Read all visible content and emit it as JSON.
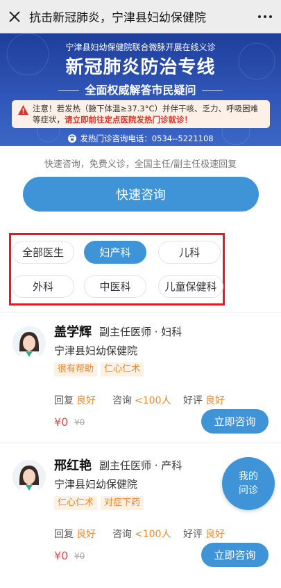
{
  "window": {
    "title": "抗击新冠肺炎，宁津县妇幼保健院",
    "close_icon": "close-icon",
    "more_icon": "more-icon"
  },
  "banner": {
    "subtitle": "宁津县妇幼保健院联合微脉开展在线义诊",
    "title": "新冠肺炎防治专线",
    "tagline": "全面权威解答市民疑问",
    "notice_part1": "注意！若发热（腋下体温≥37.3°C）并伴干咳、乏力、呼吸困难等症状，",
    "notice_highlight": "请立即前往定点医院发热门诊就诊！",
    "hotline": "发热门诊咨询电话：0534--5221108"
  },
  "consult": {
    "slogan": "快速咨询，免费义诊，全国主任/副主任极速回复",
    "button_label": "快速咨询"
  },
  "departments": {
    "items": [
      "全部医生",
      "妇产科",
      "儿科",
      "外科",
      "中医科",
      "儿童保健科"
    ],
    "selected": "妇产科"
  },
  "doctors": [
    {
      "name": "盖学辉",
      "title": "副主任医师 · 妇科",
      "hospital": "宁津县妇幼保健院",
      "tags": [
        "很有帮助",
        "仁心仁术"
      ],
      "reply_label": "回复",
      "reply_value": "良好",
      "consult_label": "咨询",
      "consult_value": "<100人",
      "rating_label": "好评",
      "rating_value": "良好",
      "price": "¥0",
      "old_price": "¥0",
      "button_label": "立即咨询"
    },
    {
      "name": "邢红艳",
      "title": "副主任医师 · 产科",
      "hospital": "宁津县妇幼保健院",
      "tags": [
        "仁心仁术",
        "对症下药"
      ],
      "reply_label": "回复",
      "reply_value": "良好",
      "consult_label": "咨询",
      "consult_value": "<100人",
      "rating_label": "好评",
      "rating_value": "良好",
      "price": "¥0",
      "old_price": "¥0",
      "button_label": "立即咨询"
    }
  ],
  "floating": {
    "line1": "我的",
    "line2": "问诊"
  },
  "colors": {
    "accent": "#3f94d8",
    "highlight_border": "#d9202a",
    "warning": "#ec8a2e",
    "price": "#e94b4b"
  }
}
